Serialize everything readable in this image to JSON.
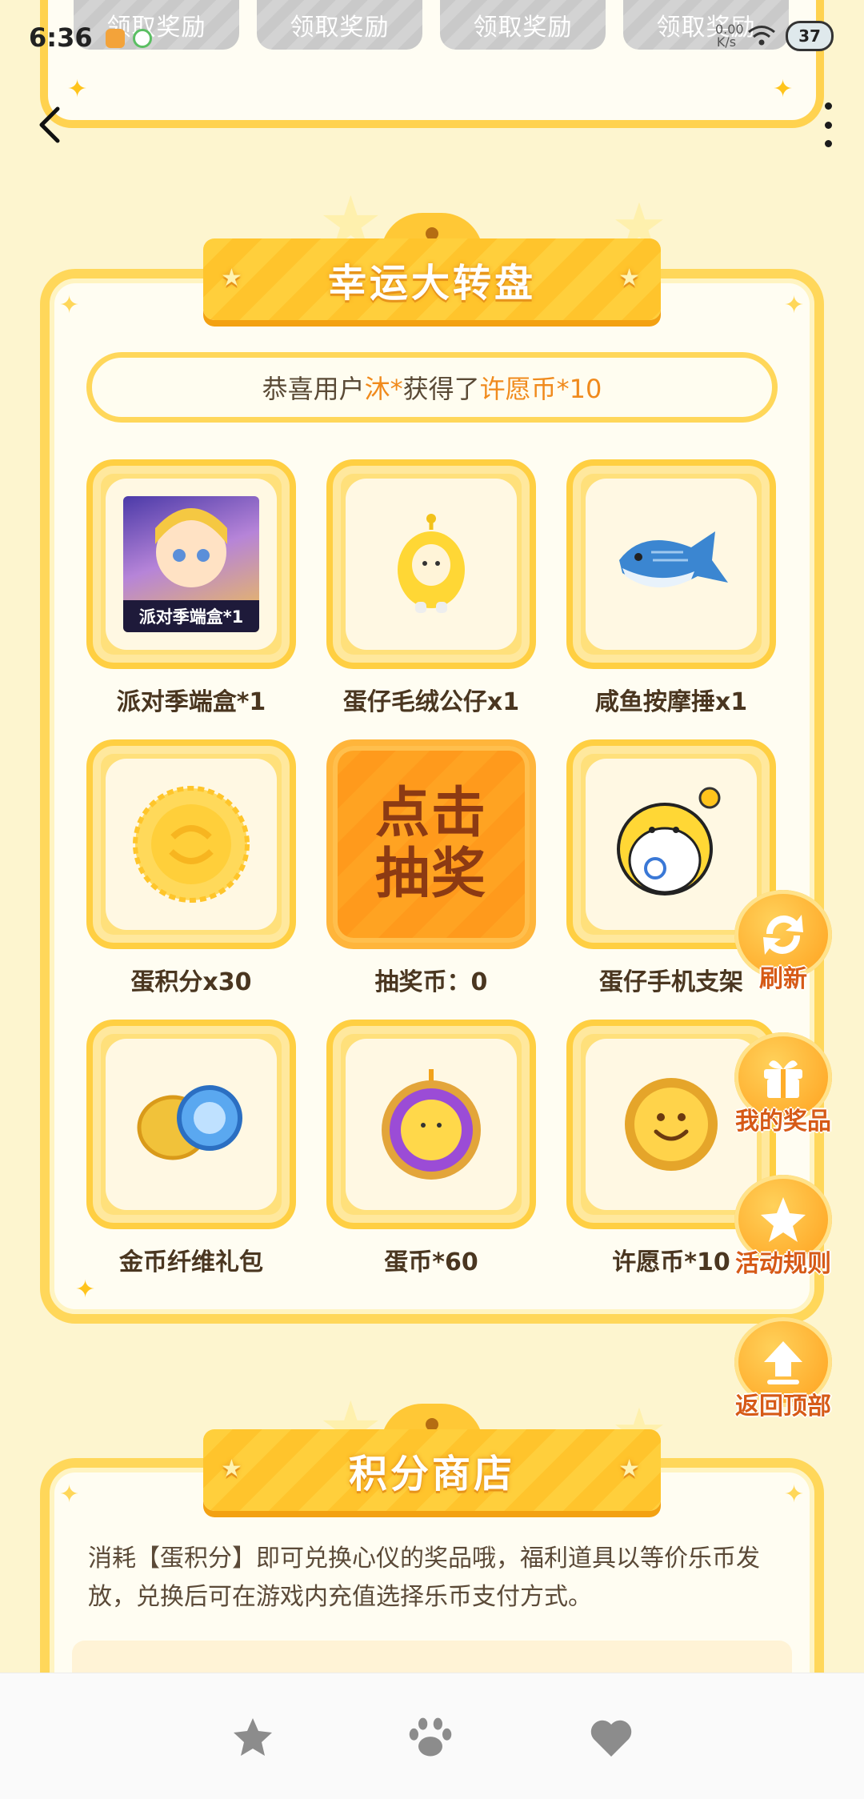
{
  "status_bar": {
    "time": "6:36",
    "net_speed": "0.00 K/s",
    "battery": "37"
  },
  "top_rewards": [
    "领取奖励",
    "领取奖励",
    "领取奖励",
    "领取奖励"
  ],
  "wheel": {
    "title": "幸运大转盘",
    "notice": {
      "prefix": "恭喜用户",
      "user": "沐*",
      "middle": "获得了",
      "prize": "许愿币*10"
    },
    "prizes": [
      {
        "label": "派对季端盒*1",
        "caption": "派对季端盒*1",
        "icon": "party-box-icon"
      },
      {
        "label": "蛋仔毛绒公仔x1",
        "icon": "eggy-plush-icon"
      },
      {
        "label": "咸鱼按摩捶x1",
        "icon": "fish-hammer-icon"
      },
      {
        "label": "蛋积分x30",
        "icon": "egg-points-coin-icon"
      },
      {
        "label": "抽奖币：0",
        "draw_line1": "点击",
        "draw_line2": "抽奖"
      },
      {
        "label": "蛋仔手机支架",
        "icon": "eggy-phone-stand-icon"
      },
      {
        "label": "金币纤维礼包",
        "icon": "coin-fiber-pack-icon"
      },
      {
        "label": "蛋币*60",
        "icon": "egg-coin-icon"
      },
      {
        "label": "许愿币*10",
        "icon": "wish-coin-icon"
      }
    ]
  },
  "side_buttons": {
    "refresh": "刷新",
    "my_prizes": "我的奖品",
    "rules": "活动规则",
    "back_to_top": "返回顶部"
  },
  "shop": {
    "title": "积分商店",
    "description": "消耗【蛋积分】即可兑换心仪的奖品哦，福利道具以等价乐币发放，兑换后可在游戏内充值选择乐币支付方式。"
  },
  "bottom_nav": [
    "star-icon",
    "paw-icon",
    "heart-icon"
  ],
  "colors": {
    "accent": "#ffc836",
    "highlight": "#f08a1c",
    "draw_button": "#ff9a1c"
  }
}
